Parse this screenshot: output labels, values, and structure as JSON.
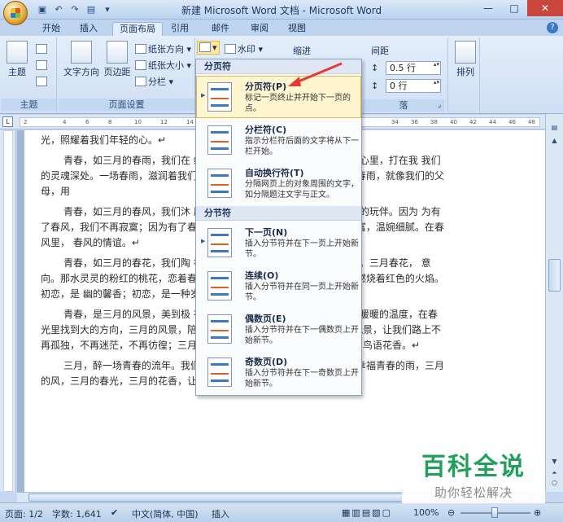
{
  "window": {
    "title": "新建 Microsoft Word 文档 - Microsoft Word",
    "minimize": "—",
    "maximize": "□",
    "close": "✕"
  },
  "tabs": [
    {
      "label": "开始"
    },
    {
      "label": "插入"
    },
    {
      "label": "页面布局"
    },
    {
      "label": "引用"
    },
    {
      "label": "邮件"
    },
    {
      "label": "审阅"
    },
    {
      "label": "视图"
    }
  ],
  "ribbon": {
    "theme_group": {
      "label": "主题",
      "button": "主题"
    },
    "page_setup_group": {
      "label": "页面设置",
      "text_direction": "文字方向",
      "margins": "页边距",
      "orientation": "纸张方向",
      "size": "纸张大小",
      "columns": "分栏"
    },
    "background": {
      "watermark": "水印"
    },
    "paragraph": {
      "indent_label": "缩进",
      "spacing_label": "间距",
      "spacing_before": "0.5 行",
      "spacing_after": "0 行",
      "group_fragment": "落"
    },
    "arrange": {
      "label": "排列"
    }
  },
  "ruler_numbers": [
    "2",
    "4",
    "6",
    "8",
    "10",
    "12",
    "14",
    "34",
    "36",
    "38",
    "40",
    "42",
    "44",
    "46",
    "48"
  ],
  "menu": {
    "section_page_breaks": "分页符",
    "section_section_breaks": "分节符",
    "items": [
      {
        "title": "分页符(P)",
        "desc": "标记一页终止并开始下一页的点。"
      },
      {
        "title": "分栏符(C)",
        "desc": "指示分栏符后面的文字将从下一栏开始。"
      },
      {
        "title": "自动换行符(T)",
        "desc": "分隔网页上的对象周围的文字，如分隔题注文字与正文。"
      },
      {
        "title": "下一页(N)",
        "desc": "插入分节符并在下一页上开始新节。"
      },
      {
        "title": "连续(O)",
        "desc": "插入分节符并在同一页上开始新节。"
      },
      {
        "title": "偶数页(E)",
        "desc": "插入分节符并在下一偶数页上开始新节。"
      },
      {
        "title": "奇数页(D)",
        "desc": "插入分节符并在下一奇数页上开始新节。"
      }
    ]
  },
  "document": {
    "paragraphs": [
      {
        "text": "光，照耀着我们年轻的心。↵",
        "indent": false
      },
      {
        "text": "青春，如三月的春雨，我们在                                  纷纷扬扬，打在青春的雨季，打在我们心里，打在我                                  我们的灵魂深处。一场春雨，滋润着我们的青春流年                                  让我们感受亲恩。三月的春雨，就像我们的父母，用                                  ",
        "indent": true
      },
      {
        "text": "青春，如三月的春风，我们沐                                  朋友，是我们的同窗，是陪伴我们成长的玩伴。因为                                  为有了春风，我们不再寂寞；因为有了春风，我们总                                  手。春风，是那样感情丰富，温婉细腻。在春风里，                                  春风的情谊。↵",
        "indent": true
      },
      {
        "text": "青春，如三月的春花，我们陶                                  初恋。花开半夏，岁月静好，浅笑安然。三月春花，                                  意向。那水灵灵的粉红的桃花，恋着春雨，恋着春雨                                  香；那深红的杜鹃，像燃烧着红色的火焰。初恋，是                                  幽的馨香；初恋，是一种岁月的沉淀。↵",
        "indent": true
      },
      {
        "text": "青春，是三月的风景，美到极                                  在春风中感受它的温润，在春光里感受暖暖的温度，在春光里找到大的方向，三月的风景，陪我们一路向梦想的地方进发；三月的风景，让我们路上不再孤独，不再迷茫，不再彷徨；三月的风景，让我们的青春更加色彩斑斓，鸟语花香。↵",
        "indent": true
      },
      {
        "text": "三月，醉一场青春的流年。我们珍惜三月，就像我们珍惜来之不易的幸福青春的雨，三月的风，三月的春光，三月的花香，让我们沉醉不知归路，兴尽晚回舟。",
        "indent": true
      }
    ]
  },
  "status": {
    "page": "页面: 1/2",
    "words": "字数: 1,641",
    "language": "中文(简体, 中国)",
    "mode": "插入",
    "zoom": "100%",
    "zoom_minus": "⊖",
    "zoom_plus": "⊕"
  },
  "watermark": {
    "title": "百科全说",
    "subtitle": "助你轻松解决"
  },
  "colors": {
    "accent_red": "#e43a3a",
    "watermark_green": "#20a15b",
    "highlight": "#fff5cf"
  }
}
